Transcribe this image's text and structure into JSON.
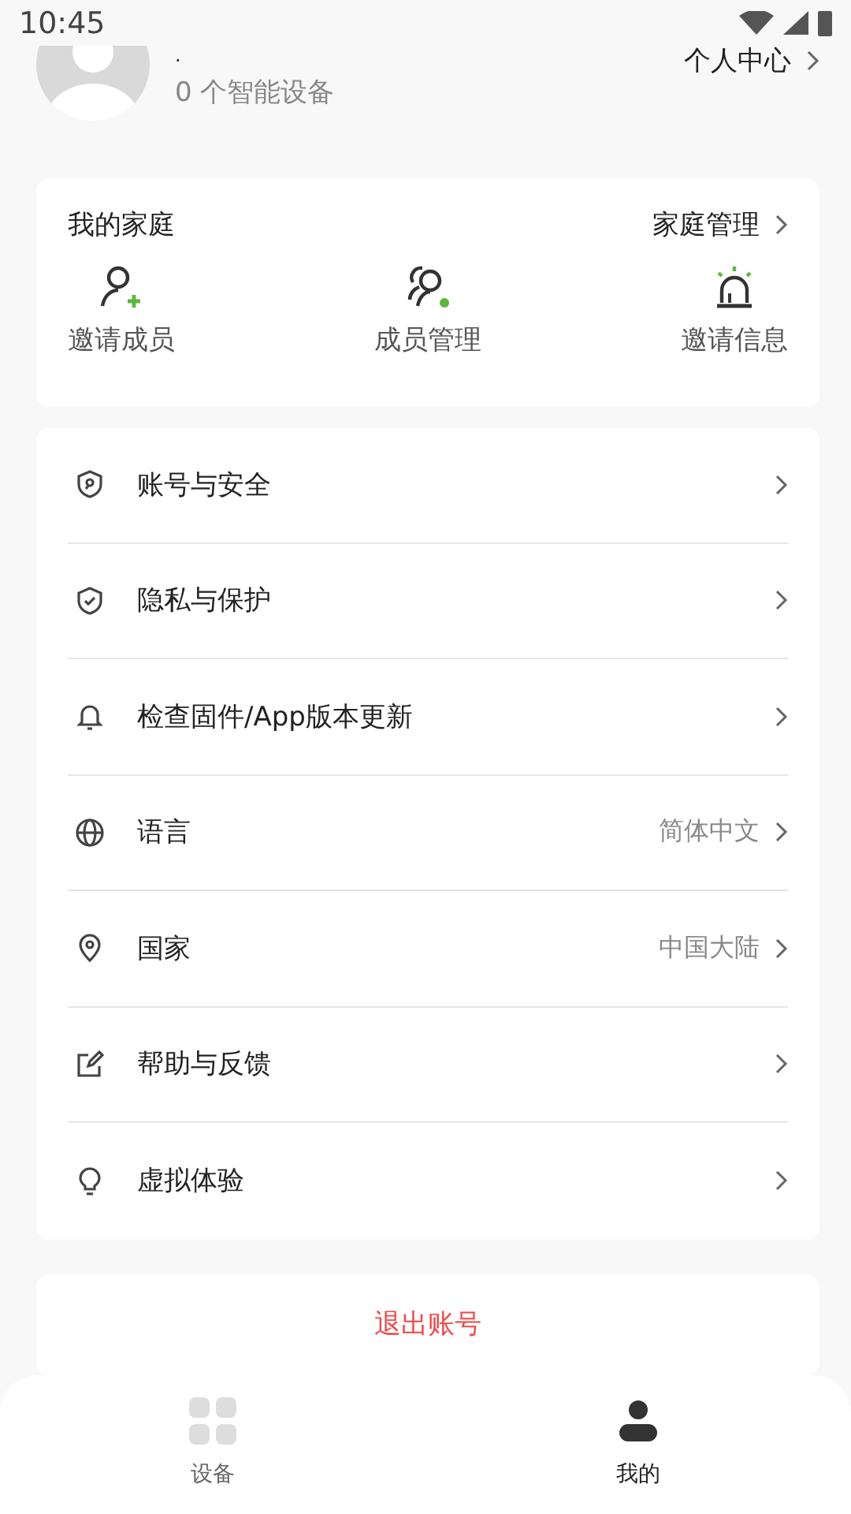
{
  "status_bar": {
    "time": "10:45"
  },
  "profile": {
    "name": ".",
    "devices": "0 个智能设备",
    "link": "个人中心"
  },
  "family": {
    "title": "我的家庭",
    "manage": "家庭管理",
    "actions": [
      {
        "kind": "invite",
        "label": "邀请成员"
      },
      {
        "kind": "members",
        "label": "成员管理"
      },
      {
        "kind": "alarm",
        "label": "邀请信息"
      }
    ]
  },
  "settings": [
    {
      "kind": "account",
      "label": "账号与安全"
    },
    {
      "kind": "privacy",
      "label": "隐私与保护"
    },
    {
      "kind": "update",
      "label": "检查固件/App版本更新"
    },
    {
      "kind": "language",
      "label": "语言",
      "value": "简体中文"
    },
    {
      "kind": "country",
      "label": "国家",
      "value": "中国大陆"
    },
    {
      "kind": "feedback",
      "label": "帮助与反馈"
    },
    {
      "kind": "trial",
      "label": "虚拟体验"
    }
  ],
  "logout": "退出账号",
  "tabs": [
    {
      "kind": "devices",
      "label": "设备",
      "selected": false
    },
    {
      "kind": "me",
      "label": "我的",
      "selected": true
    }
  ]
}
